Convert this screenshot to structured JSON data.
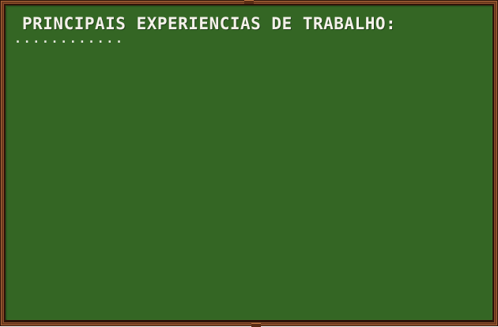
{
  "board": {
    "title": "PRINCIPAIS EXPERIENCIAS DE TRABALHO:",
    "body_text": "............",
    "colors": {
      "slate": "#346624",
      "frame_wood": "#8a4e2b",
      "frame_dark": "#2b1208",
      "text": "#f4f1ea"
    }
  }
}
